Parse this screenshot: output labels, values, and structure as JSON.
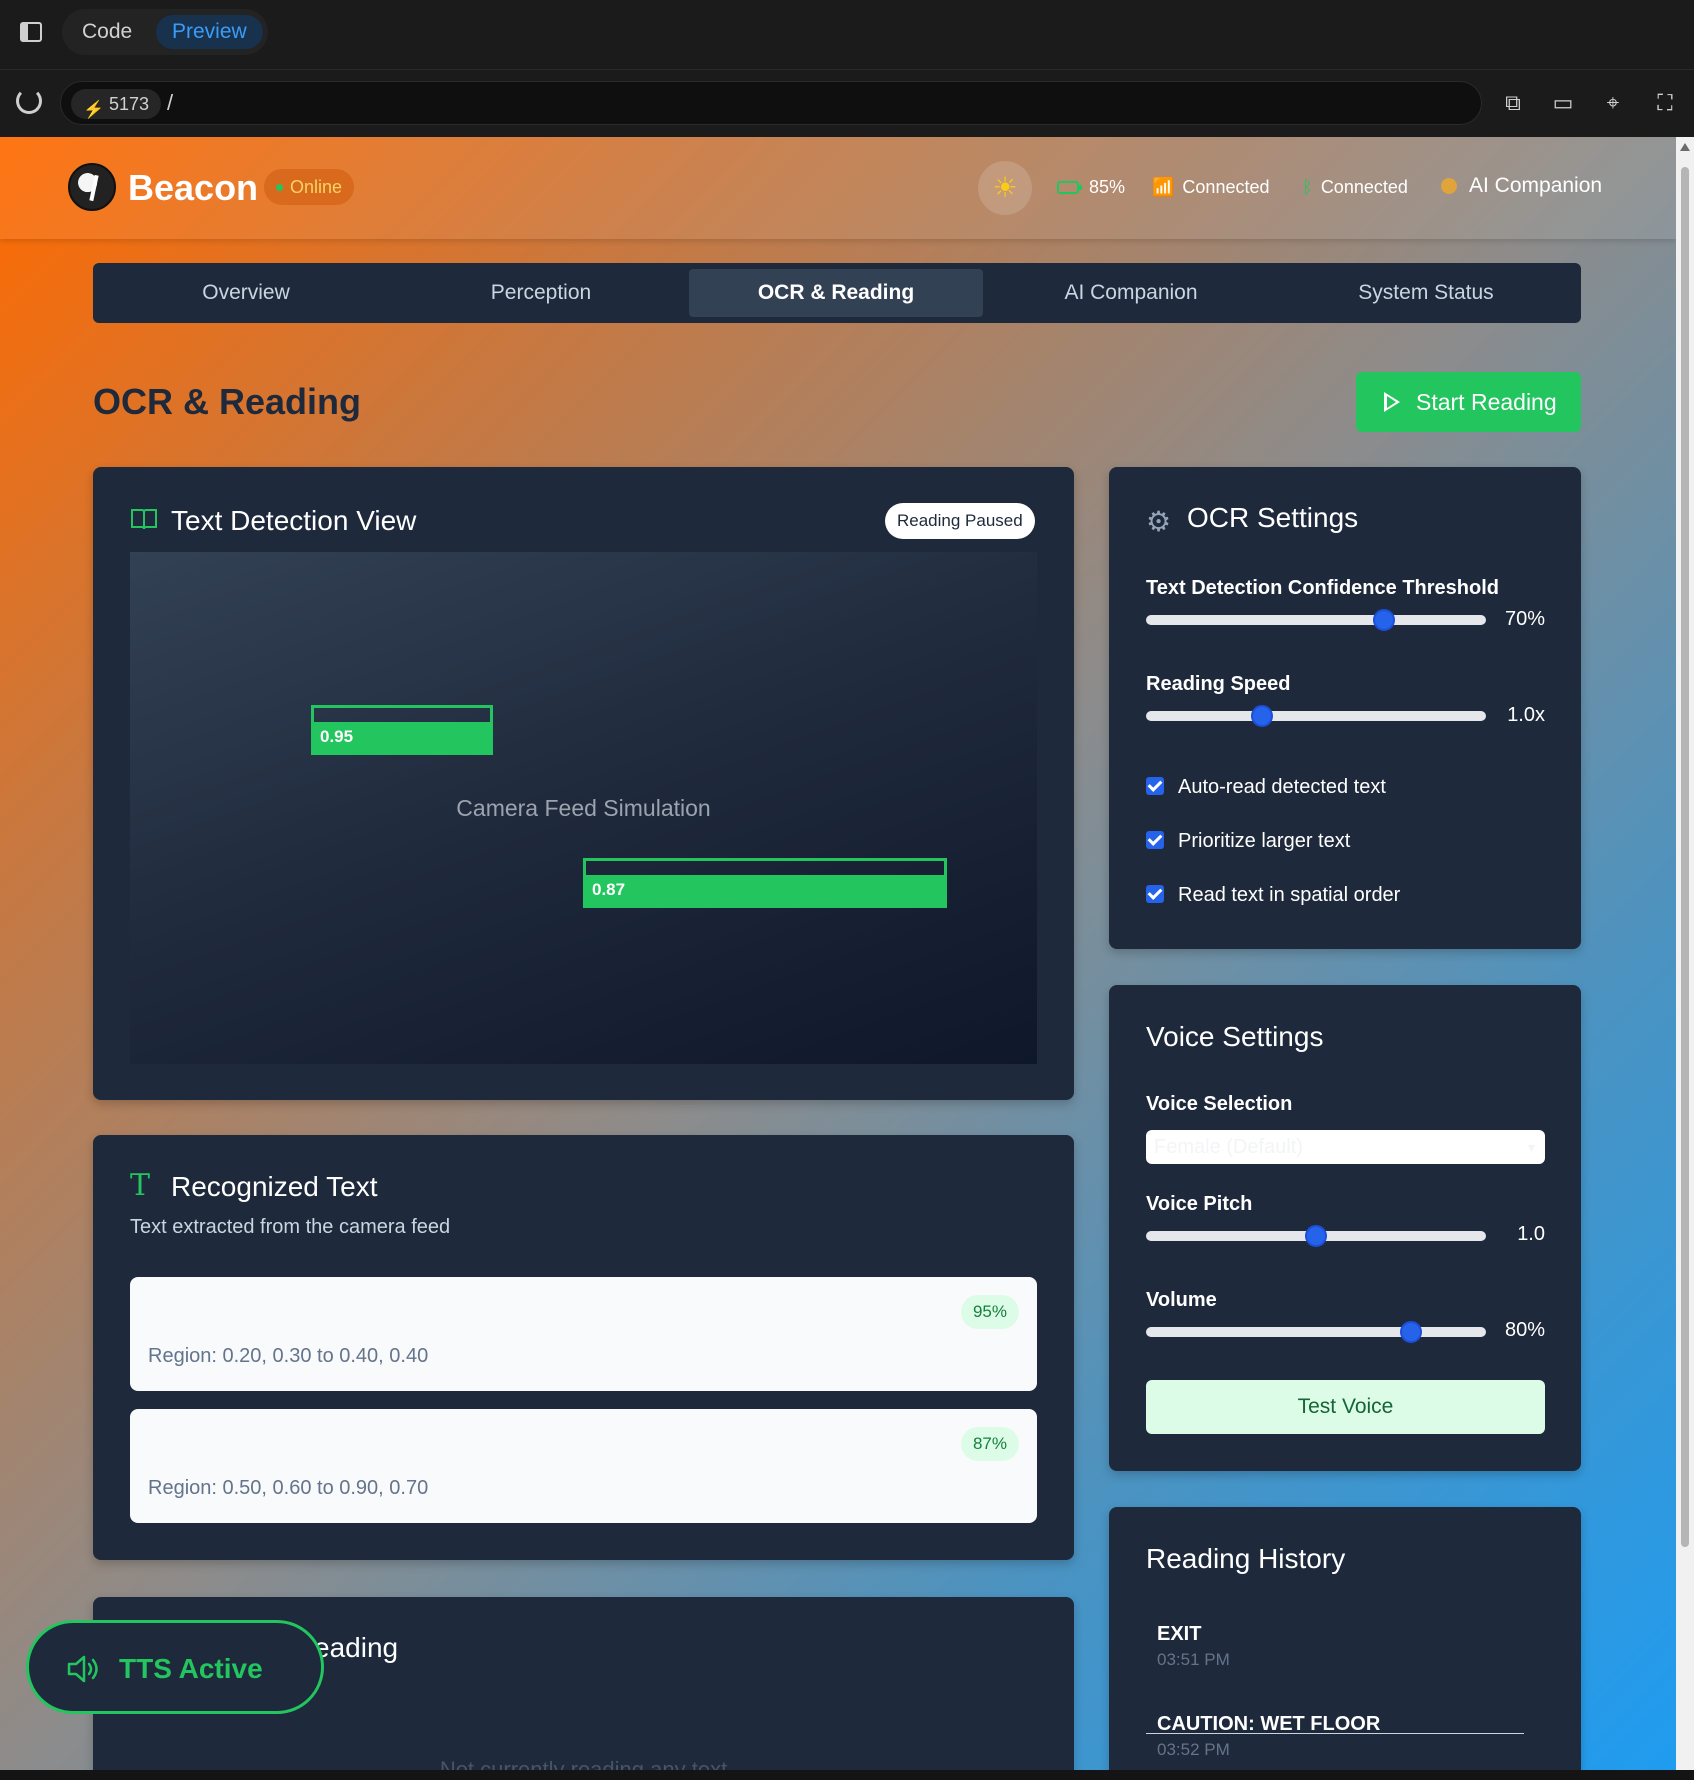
{
  "browser": {
    "mode_tabs": [
      "Code",
      "Preview"
    ],
    "port": "5173",
    "path": "/"
  },
  "header": {
    "brand": "Beacon",
    "status": "Online",
    "battery": "85%",
    "wifi": "Connected",
    "bluetooth": "Connected",
    "ai": "AI Companion"
  },
  "tabs": [
    "Overview",
    "Perception",
    "OCR & Reading",
    "AI Companion",
    "System Status"
  ],
  "page": {
    "title": "OCR & Reading",
    "start_button": "Start Reading"
  },
  "detection": {
    "title": "Text Detection View",
    "status_badge": "Reading Paused",
    "camera_label": "Camera Feed Simulation",
    "boxes": [
      {
        "label": "0.95",
        "confidence": 0.95
      },
      {
        "label": "0.87",
        "confidence": 0.87
      }
    ]
  },
  "recognized": {
    "title": "Recognized Text",
    "subtitle": "Text extracted from the camera feed",
    "items": [
      {
        "confidence": "95%",
        "region": "Region: 0.20, 0.30 to 0.40, 0.40"
      },
      {
        "confidence": "87%",
        "region": "Region: 0.50, 0.60 to 0.90, 0.70"
      }
    ]
  },
  "ocr_settings": {
    "title": "OCR Settings",
    "threshold_label": "Text Detection Confidence Threshold",
    "threshold_value": "70%",
    "threshold_level": 0.7,
    "speed_label": "Reading Speed",
    "speed_value": "1.0x",
    "speed_level": 0.34,
    "checkboxes": [
      "Auto-read detected text",
      "Prioritize larger text",
      "Read text in spatial order"
    ]
  },
  "voice_settings": {
    "title": "Voice Settings",
    "voice_label": "Voice Selection",
    "voice_value": "Female (Default)",
    "pitch_label": "Voice Pitch",
    "pitch_value": "1.0",
    "pitch_level": 0.5,
    "volume_label": "Volume",
    "volume_value": "80%",
    "volume_level": 0.78,
    "test_button": "Test Voice"
  },
  "history": {
    "title": "Reading History",
    "items": [
      {
        "text": "EXIT",
        "time": "03:51 PM"
      },
      {
        "text": "CAUTION: WET FLOOR",
        "time": "03:52 PM"
      }
    ]
  },
  "current": {
    "title_visible": "eading",
    "empty": "Not currently reading any text"
  },
  "tts": {
    "label": "TTS Active"
  },
  "colors": {
    "accent_green": "#22c55e",
    "card_bg": "#1e293b",
    "slider_blue": "#2563eb"
  }
}
